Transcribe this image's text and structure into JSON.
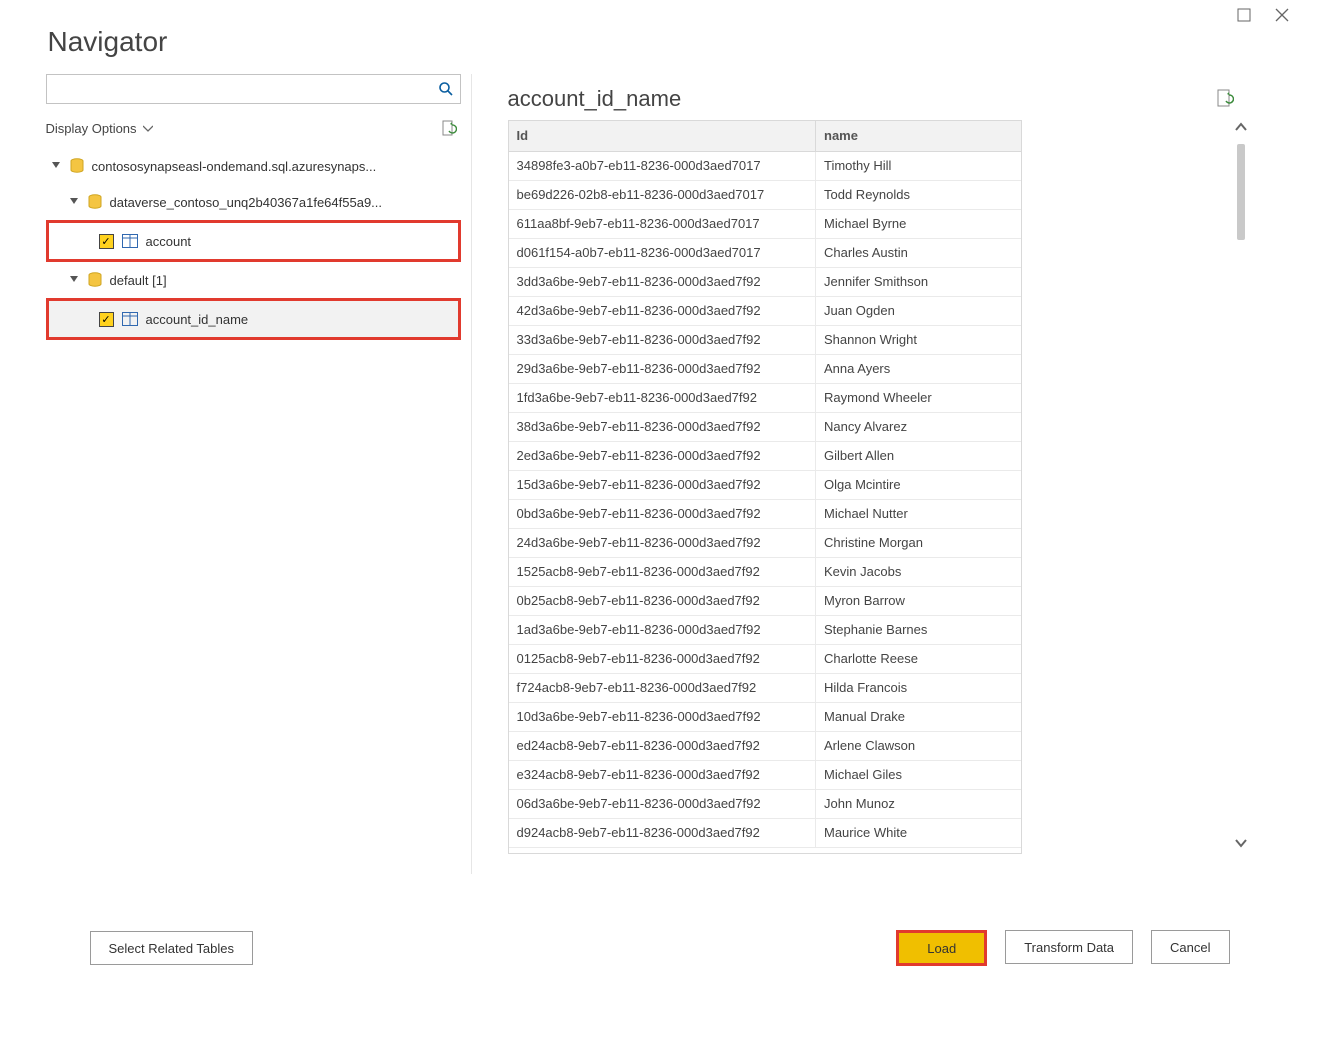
{
  "title": "Navigator",
  "search": {
    "placeholder": ""
  },
  "display_options_label": "Display Options",
  "tree": {
    "server": "contososynapseasl-ondemand.sql.azuresynaps...",
    "database": "dataverse_contoso_unq2b40367a1fe64f55a9...",
    "table_account": "account",
    "default_label": "default [1]",
    "table_account_id_name": "account_id_name"
  },
  "preview": {
    "title": "account_id_name",
    "columns": {
      "id": "Id",
      "name": "name"
    },
    "rows": [
      {
        "id": "34898fe3-a0b7-eb11-8236-000d3aed7017",
        "name": "Timothy Hill"
      },
      {
        "id": "be69d226-02b8-eb11-8236-000d3aed7017",
        "name": "Todd Reynolds"
      },
      {
        "id": "611aa8bf-9eb7-eb11-8236-000d3aed7017",
        "name": "Michael Byrne"
      },
      {
        "id": "d061f154-a0b7-eb11-8236-000d3aed7017",
        "name": "Charles Austin"
      },
      {
        "id": "3dd3a6be-9eb7-eb11-8236-000d3aed7f92",
        "name": "Jennifer Smithson"
      },
      {
        "id": "42d3a6be-9eb7-eb11-8236-000d3aed7f92",
        "name": "Juan Ogden"
      },
      {
        "id": "33d3a6be-9eb7-eb11-8236-000d3aed7f92",
        "name": "Shannon Wright"
      },
      {
        "id": "29d3a6be-9eb7-eb11-8236-000d3aed7f92",
        "name": "Anna Ayers"
      },
      {
        "id": "1fd3a6be-9eb7-eb11-8236-000d3aed7f92",
        "name": "Raymond Wheeler"
      },
      {
        "id": "38d3a6be-9eb7-eb11-8236-000d3aed7f92",
        "name": "Nancy Alvarez"
      },
      {
        "id": "2ed3a6be-9eb7-eb11-8236-000d3aed7f92",
        "name": "Gilbert Allen"
      },
      {
        "id": "15d3a6be-9eb7-eb11-8236-000d3aed7f92",
        "name": "Olga Mcintire"
      },
      {
        "id": "0bd3a6be-9eb7-eb11-8236-000d3aed7f92",
        "name": "Michael Nutter"
      },
      {
        "id": "24d3a6be-9eb7-eb11-8236-000d3aed7f92",
        "name": "Christine Morgan"
      },
      {
        "id": "1525acb8-9eb7-eb11-8236-000d3aed7f92",
        "name": "Kevin Jacobs"
      },
      {
        "id": "0b25acb8-9eb7-eb11-8236-000d3aed7f92",
        "name": "Myron Barrow"
      },
      {
        "id": "1ad3a6be-9eb7-eb11-8236-000d3aed7f92",
        "name": "Stephanie Barnes"
      },
      {
        "id": "0125acb8-9eb7-eb11-8236-000d3aed7f92",
        "name": "Charlotte Reese"
      },
      {
        "id": "f724acb8-9eb7-eb11-8236-000d3aed7f92",
        "name": "Hilda Francois"
      },
      {
        "id": "10d3a6be-9eb7-eb11-8236-000d3aed7f92",
        "name": "Manual Drake"
      },
      {
        "id": "ed24acb8-9eb7-eb11-8236-000d3aed7f92",
        "name": "Arlene Clawson"
      },
      {
        "id": "e324acb8-9eb7-eb11-8236-000d3aed7f92",
        "name": "Michael Giles"
      },
      {
        "id": "06d3a6be-9eb7-eb11-8236-000d3aed7f92",
        "name": "John Munoz"
      },
      {
        "id": "d924acb8-9eb7-eb11-8236-000d3aed7f92",
        "name": "Maurice White"
      }
    ]
  },
  "footer": {
    "select_related": "Select Related Tables",
    "load": "Load",
    "transform": "Transform Data",
    "cancel": "Cancel"
  }
}
